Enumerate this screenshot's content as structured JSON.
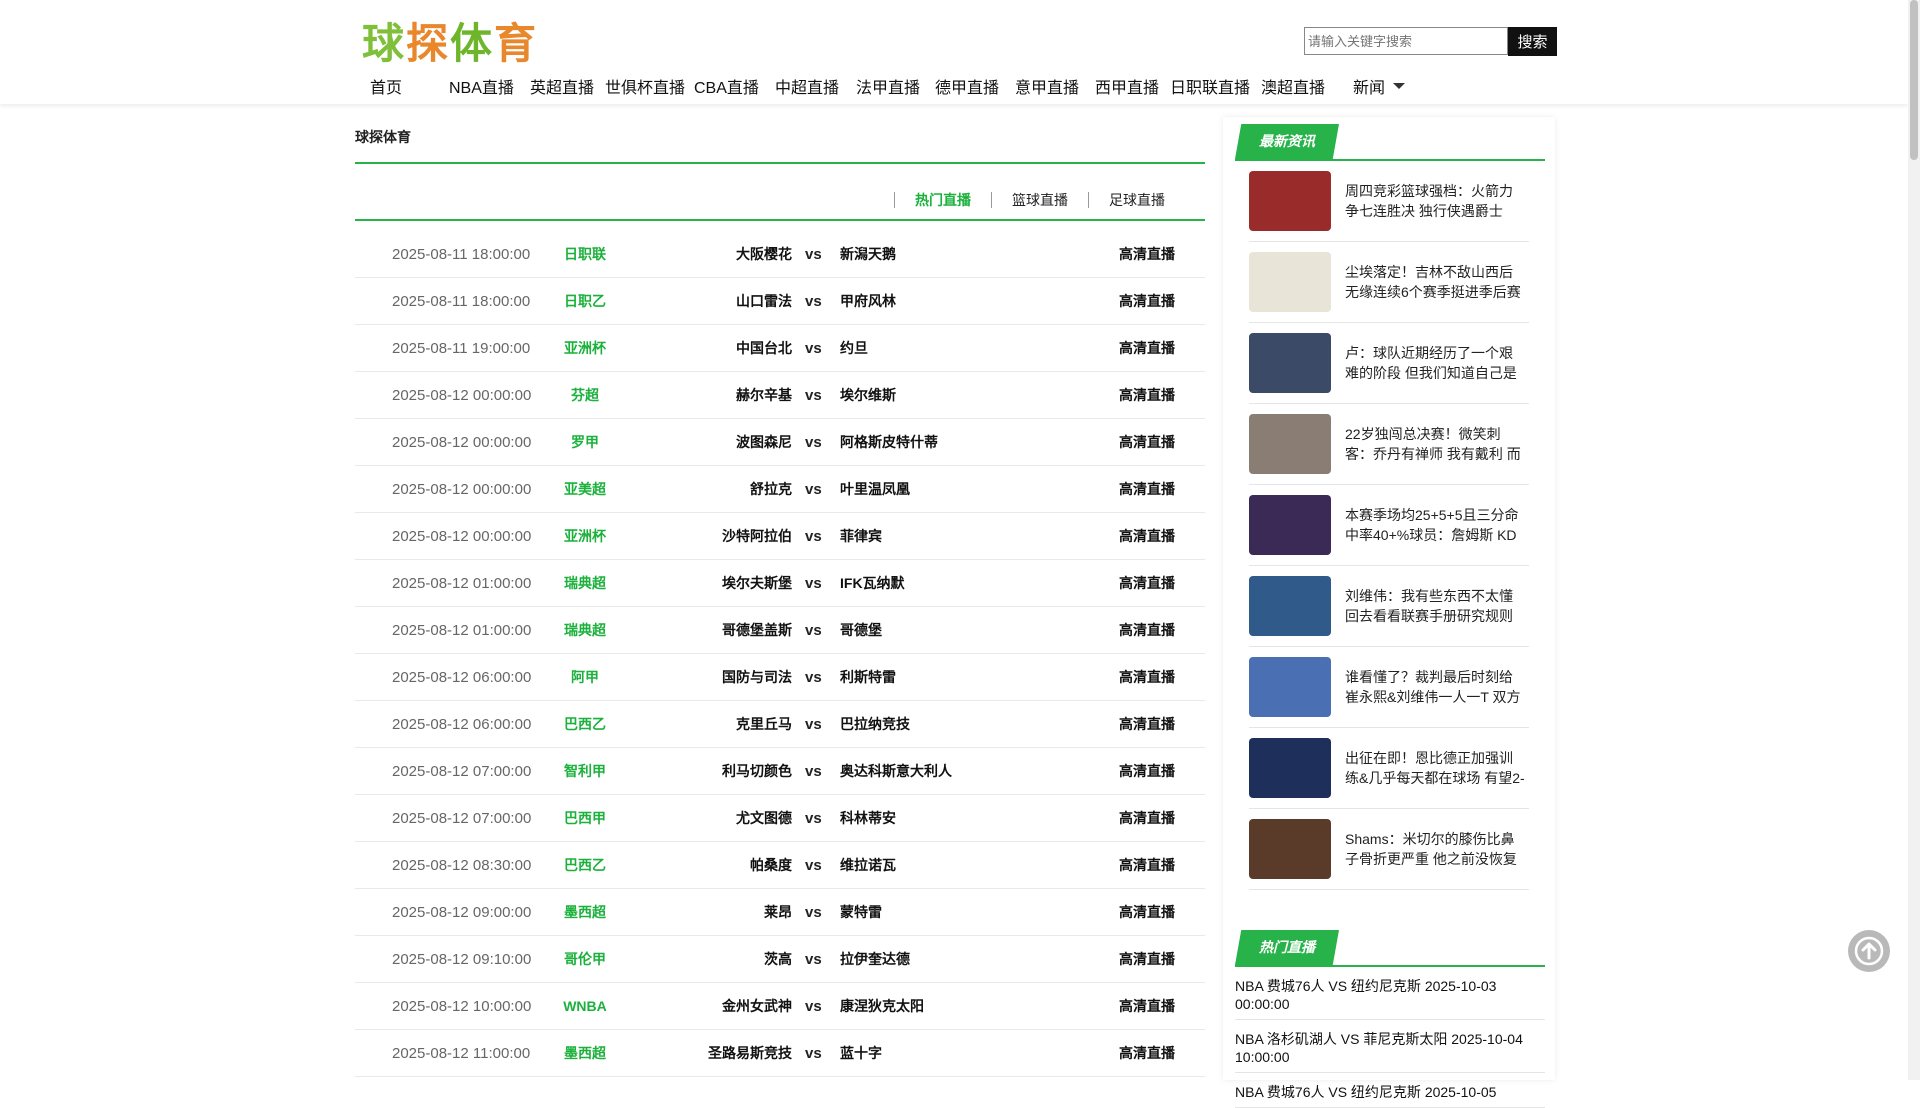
{
  "site": {
    "logo_chars": [
      "球",
      "探",
      "体",
      "育"
    ],
    "search": {
      "placeholder": "请输入关键字搜索",
      "button": "搜索"
    }
  },
  "nav": {
    "items": [
      "首页",
      "NBA直播",
      "英超直播",
      "世俱杯直播",
      "CBA直播",
      "中超直播",
      "法甲直播",
      "德甲直播",
      "意甲直播",
      "西甲直播",
      "日职联直播",
      "澳超直播"
    ],
    "more": "新闻"
  },
  "main": {
    "title": "球探体育",
    "tabs": [
      "热门直播",
      "篮球直播",
      "足球直播"
    ],
    "active_tab": 0,
    "vs_label": "vs",
    "matches": [
      {
        "time": "2025-08-11 18:00:00",
        "league": "日职联",
        "home": "大阪樱花",
        "away": "新潟天鹅",
        "live": "高清直播"
      },
      {
        "time": "2025-08-11 18:00:00",
        "league": "日职乙",
        "home": "山口雷法",
        "away": "甲府风林",
        "live": "高清直播"
      },
      {
        "time": "2025-08-11 19:00:00",
        "league": "亚洲杯",
        "home": "中国台北",
        "away": "约旦",
        "live": "高清直播"
      },
      {
        "time": "2025-08-12 00:00:00",
        "league": "芬超",
        "home": "赫尔辛基",
        "away": "埃尔维斯",
        "live": "高清直播"
      },
      {
        "time": "2025-08-12 00:00:00",
        "league": "罗甲",
        "home": "波图森尼",
        "away": "阿格斯皮特什蒂",
        "live": "高清直播"
      },
      {
        "time": "2025-08-12 00:00:00",
        "league": "亚美超",
        "home": "舒拉克",
        "away": "叶里温凤凰",
        "live": "高清直播"
      },
      {
        "time": "2025-08-12 00:00:00",
        "league": "亚洲杯",
        "home": "沙特阿拉伯",
        "away": "菲律宾",
        "live": "高清直播"
      },
      {
        "time": "2025-08-12 01:00:00",
        "league": "瑞典超",
        "home": "埃尔夫斯堡",
        "away": "IFK瓦纳默",
        "live": "高清直播"
      },
      {
        "time": "2025-08-12 01:00:00",
        "league": "瑞典超",
        "home": "哥德堡盖斯",
        "away": "哥德堡",
        "live": "高清直播"
      },
      {
        "time": "2025-08-12 06:00:00",
        "league": "阿甲",
        "home": "国防与司法",
        "away": "利斯特雷",
        "live": "高清直播"
      },
      {
        "time": "2025-08-12 06:00:00",
        "league": "巴西乙",
        "home": "克里丘马",
        "away": "巴拉纳竞技",
        "live": "高清直播"
      },
      {
        "time": "2025-08-12 07:00:00",
        "league": "智利甲",
        "home": "利马切颜色",
        "away": "奥达科斯意大利人",
        "live": "高清直播"
      },
      {
        "time": "2025-08-12 07:00:00",
        "league": "巴西甲",
        "home": "尤文图德",
        "away": "科林蒂安",
        "live": "高清直播"
      },
      {
        "time": "2025-08-12 08:30:00",
        "league": "巴西乙",
        "home": "帕桑度",
        "away": "维拉诺瓦",
        "live": "高清直播"
      },
      {
        "time": "2025-08-12 09:00:00",
        "league": "墨西超",
        "home": "莱昂",
        "away": "蒙特雷",
        "live": "高清直播"
      },
      {
        "time": "2025-08-12 09:10:00",
        "league": "哥伦甲",
        "home": "茨高",
        "away": "拉伊奎达德",
        "live": "高清直播"
      },
      {
        "time": "2025-08-12 10:00:00",
        "league": "WNBA",
        "home": "金州女武神",
        "away": "康涅狄克太阳",
        "live": "高清直播"
      },
      {
        "time": "2025-08-12 11:00:00",
        "league": "墨西超",
        "home": "圣路易斯竞技",
        "away": "蓝十字",
        "live": "高清直播"
      }
    ]
  },
  "sidebar": {
    "news_title": "最新资讯",
    "news": [
      {
        "text": "周四竞彩篮球强档：火箭力争七连胜决 独行侠遇爵士",
        "thumb_color": "#9a2b2b"
      },
      {
        "text": "尘埃落定！吉林不敌山西后无缘连续6个赛季挺进季后赛",
        "thumb_color": "#e9e4d8"
      },
      {
        "text": "卢：球队近期经历了一个艰难的阶段 但我们知道自己是",
        "thumb_color": "#3b4a66"
      },
      {
        "text": "22岁独闯总决赛！微笑刺客：乔丹有禅师 我有戴利 而",
        "thumb_color": "#8a7d74"
      },
      {
        "text": "本赛季场均25+5+5且三分命中率40+%球员：詹姆斯 KD",
        "thumb_color": "#3a2a55"
      },
      {
        "text": "刘维伟：我有些东西不太懂 回去看看联赛手册研究规则",
        "thumb_color": "#2f5a8a"
      },
      {
        "text": "谁看懂了？裁判最后时刻给崔永熙&刘维伟一人一T 双方",
        "thumb_color": "#4b6fb3"
      },
      {
        "text": "出征在即！恩比德正加强训练&几乎每天都在球场 有望2-",
        "thumb_color": "#1d2f5a"
      },
      {
        "text": "Shams：米切尔的膝伤比鼻子骨折更严重 他之前没恢复",
        "thumb_color": "#5a3b2a"
      }
    ],
    "hot_title": "热门直播",
    "hot": [
      "NBA 费城76人 VS 纽约尼克斯 2025-10-03 00:00:00",
      "NBA 洛杉矶湖人 VS 菲尼克斯太阳 2025-10-04 10:00:00",
      "NBA 费城76人 VS 纽约尼克斯 2025-10-05"
    ]
  }
}
